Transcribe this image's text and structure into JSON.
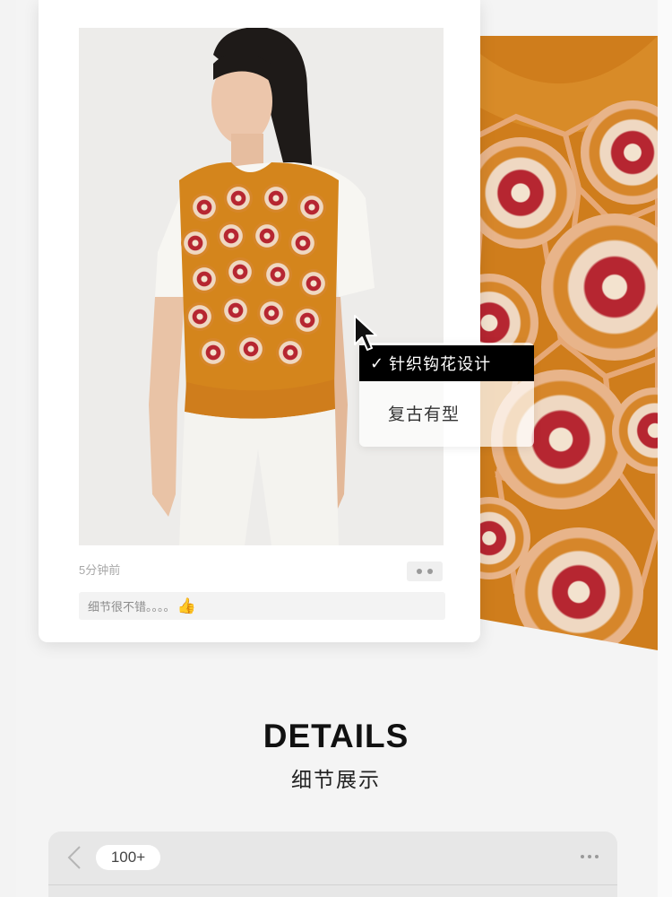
{
  "post": {
    "time_ago": "5分钟前",
    "comment": "细节很不错。。。。",
    "comment_emoji": "👍"
  },
  "tags": {
    "selected_label": "针织钩花设计",
    "option_label": "复古有型"
  },
  "details": {
    "title": "DETAILS",
    "subtitle": "细节展示"
  },
  "bottom_bar": {
    "count": "100+"
  },
  "colors": {
    "sweater_orange": "#d4851c",
    "crochet_red": "#b62631",
    "crochet_cream": "#efd8c2",
    "crochet_peach": "#e6a876"
  }
}
